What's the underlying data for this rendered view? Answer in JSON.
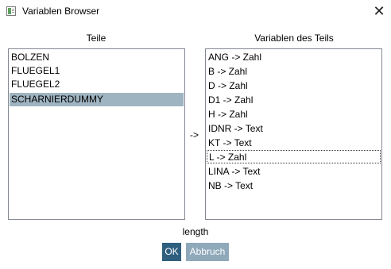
{
  "window": {
    "title": "Variablen Browser",
    "close_glyph": "✕",
    "icon": "app-window-icon"
  },
  "left": {
    "label": "Teile",
    "items": [
      "BOLZEN",
      "FLUEGEL1",
      "FLUEGEL2",
      "SCHARNIERDUMMY"
    ],
    "selected_index": 3
  },
  "middle": {
    "arrow": "->"
  },
  "right": {
    "label": "Variablen des Teils",
    "items": [
      "ANG -> Zahl",
      "B -> Zahl",
      "D -> Zahl",
      "D1 -> Zahl",
      "H -> Zahl",
      "IDNR -> Text",
      "KT -> Text",
      "L -> Zahl",
      "LINA -> Text",
      "NB -> Text"
    ],
    "focused_index": 7
  },
  "status": "length",
  "buttons": {
    "ok": "OK",
    "cancel": "Abbruch"
  },
  "colors": {
    "selected_bg": "#9fb4c1",
    "ok_bg": "#2f5f7f",
    "cancel_bg": "#8fa8ba"
  }
}
